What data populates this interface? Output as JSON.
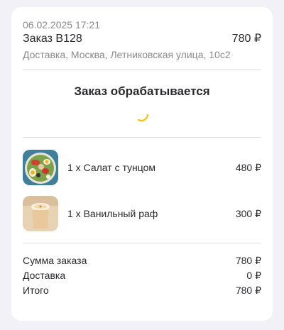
{
  "order": {
    "datetime": "06.02.2025 17:21",
    "number": "Заказ B128",
    "price": "780 ₽",
    "address": "Доставка, Москва, Летниковская улица, 10с2"
  },
  "status": {
    "title": "Заказ обрабатывается",
    "spinner_color": "#f5c518"
  },
  "items": [
    {
      "name": "1 x Салат с тунцом",
      "price": "480 ₽",
      "image": "tuna-salad"
    },
    {
      "name": "1 x Ванильный раф",
      "price": "300 ₽",
      "image": "vanilla-raf"
    }
  ],
  "summary": {
    "subtotal_label": "Сумма заказа",
    "subtotal_value": "780 ₽",
    "delivery_label": "Доставка",
    "delivery_value": "0 ₽",
    "total_label": "Итого",
    "total_value": "780 ₽"
  }
}
